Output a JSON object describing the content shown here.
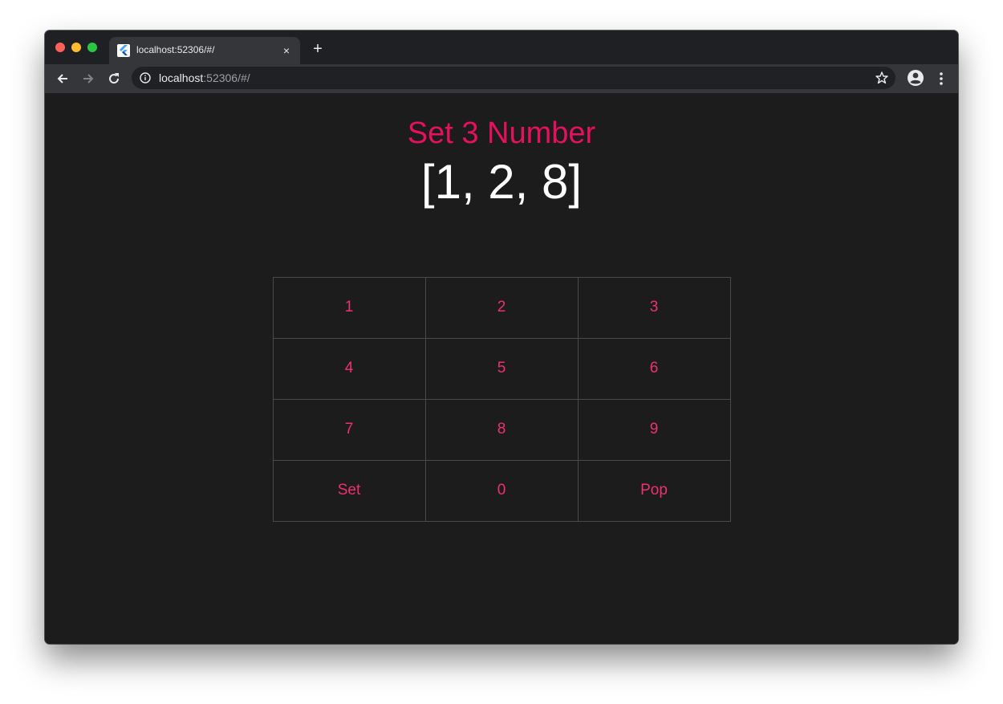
{
  "browser": {
    "tab_title": "localhost:52306/#/",
    "url_host": "localhost",
    "url_rest": ":52306/#/",
    "new_tab": "+",
    "close_tab": "×"
  },
  "app": {
    "heading": "Set 3 Number",
    "number_list": "[1, 2, 8]",
    "accent_color": "#e5115e",
    "keys": [
      {
        "label": "1"
      },
      {
        "label": "2"
      },
      {
        "label": "3"
      },
      {
        "label": "4"
      },
      {
        "label": "5"
      },
      {
        "label": "6"
      },
      {
        "label": "7"
      },
      {
        "label": "8"
      },
      {
        "label": "9"
      },
      {
        "label": "Set"
      },
      {
        "label": "0"
      },
      {
        "label": "Pop"
      }
    ]
  },
  "icons": {
    "favicon": "flutter-icon",
    "back": "arrow-left-icon",
    "forward": "arrow-right-icon",
    "reload": "reload-icon",
    "info": "info-icon",
    "bookmark": "star-icon",
    "profile": "account-circle-icon",
    "menu": "more-vert-icon"
  }
}
